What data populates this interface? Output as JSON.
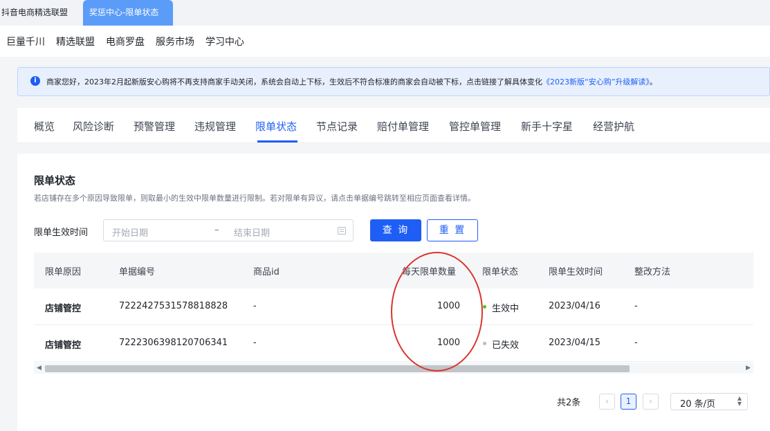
{
  "browser_tabs": [
    {
      "label": "抖音电商精选联盟"
    },
    {
      "label": "奖惩中心-限单状态"
    }
  ],
  "top_nav": {
    "items": [
      {
        "label": "巨量千川"
      },
      {
        "label": "精选联盟"
      },
      {
        "label": "电商罗盘"
      },
      {
        "label": "服务市场"
      },
      {
        "label": "学习中心"
      }
    ]
  },
  "notice": {
    "icon": "info-icon",
    "text": "商家您好，2023年2月起新版安心购将不再支持商家手动关闭，系统会自动上下标，生效后不符合标准的商家会自动被下标，点击链接了解具体变化",
    "link": "《2023新版“安心购”升级解读》",
    "suffix": "。"
  },
  "sub_tabs": {
    "items": [
      {
        "label": "概览"
      },
      {
        "label": "风险诊断"
      },
      {
        "label": "预警管理"
      },
      {
        "label": "违规管理"
      },
      {
        "label": "限单状态"
      },
      {
        "label": "节点记录"
      },
      {
        "label": "赔付单管理"
      },
      {
        "label": "管控单管理"
      },
      {
        "label": "新手十字星"
      },
      {
        "label": "经营护航"
      }
    ],
    "active": "限单状态"
  },
  "section": {
    "title": "限单状态",
    "description": "若店铺存在多个原因导致限单，则取最小的生效中限单数量进行限制。若对限单有异议，请点击单据编号跳转至相应页面查看详情。"
  },
  "filter": {
    "label": "限单生效时间",
    "start_placeholder": "开始日期",
    "separator": "–",
    "end_placeholder": "结束日期",
    "query_label": "查 询",
    "reset_label": "重 置"
  },
  "table": {
    "headers": {
      "reason": "限单原因",
      "doc_no": "单据编号",
      "product_id": "商品id",
      "daily_limit": "每天限单数量",
      "status": "限单状态",
      "effective_time": "限单生效时间",
      "fix_method": "整改方法"
    },
    "rows": [
      {
        "reason": "店铺管控",
        "doc_no": "7222427531578818828",
        "product_id": "-",
        "daily_limit": "1000",
        "status": "生效中",
        "status_color": "#52c41a",
        "effective_time": "2023/04/16",
        "fix_method": "-"
      },
      {
        "reason": "店铺管控",
        "doc_no": "7222306398120706341",
        "product_id": "-",
        "daily_limit": "1000",
        "status": "已失效",
        "status_color": "#b6bcc6",
        "effective_time": "2023/04/15",
        "fix_method": "-"
      }
    ]
  },
  "pagination": {
    "total_text": "共2条",
    "current_page": "1",
    "page_size": "20 条/页"
  },
  "colors": {
    "accent": "#1e5ef5",
    "annotation": "#d9342b"
  }
}
